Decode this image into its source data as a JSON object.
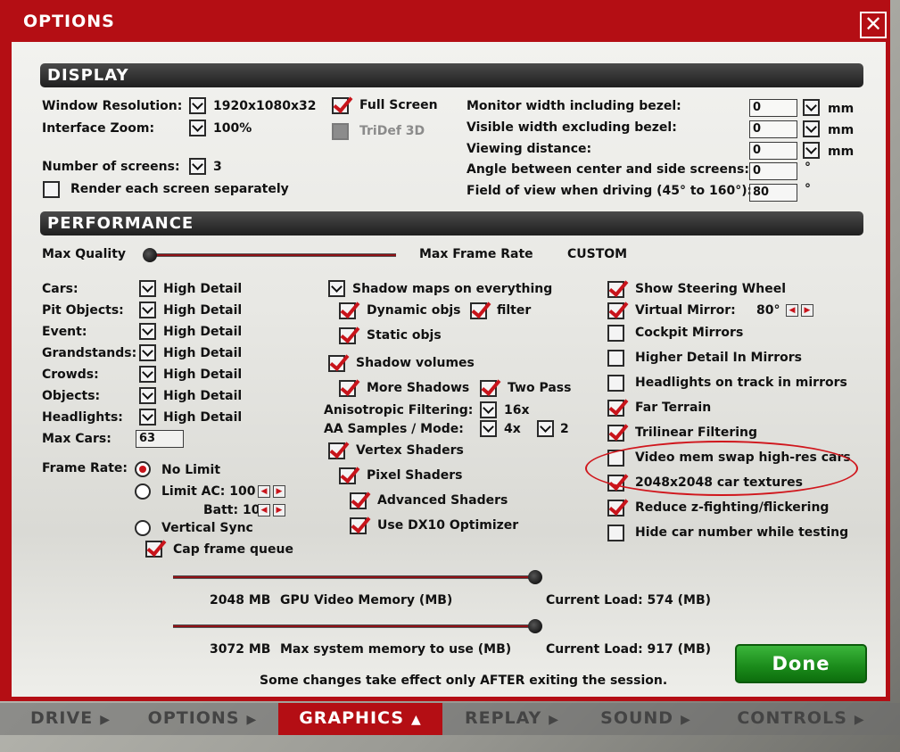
{
  "window": {
    "title": "OPTIONS",
    "close_icon": "close-icon",
    "accent": "#b40e14"
  },
  "display": {
    "header": "DISPLAY",
    "window_resolution_label": "Window Resolution:",
    "window_resolution_value": "1920x1080x32",
    "interface_zoom_label": "Interface Zoom:",
    "interface_zoom_value": "100%",
    "number_of_screens_label": "Number of screens:",
    "number_of_screens_value": "3",
    "render_separately_label": "Render each screen separately",
    "full_screen_label": "Full Screen",
    "tridef_label": "TriDef 3D",
    "monitor_width_label": "Monitor width including bezel:",
    "monitor_width_value": "0",
    "visible_width_label": "Visible width excluding bezel:",
    "visible_width_value": "0",
    "viewing_distance_label": "Viewing distance:",
    "viewing_distance_value": "0",
    "angle_label": "Angle between center and side screens:",
    "angle_value": "0",
    "fov_label": "Field of view when driving (45° to 160°):",
    "fov_value": "80",
    "unit_mm": "mm",
    "unit_deg": "°"
  },
  "performance": {
    "header": "PERFORMANCE",
    "max_quality_label": "Max Quality",
    "max_frame_rate_label": "Max Frame Rate",
    "preset_value": "CUSTOM",
    "detail_rows": [
      {
        "label": "Cars:",
        "value": "High Detail"
      },
      {
        "label": "Pit Objects:",
        "value": "High Detail"
      },
      {
        "label": "Event:",
        "value": "High Detail"
      },
      {
        "label": "Grandstands:",
        "value": "High Detail"
      },
      {
        "label": "Crowds:",
        "value": "High Detail"
      },
      {
        "label": "Objects:",
        "value": "High Detail"
      },
      {
        "label": "Headlights:",
        "value": "High Detail"
      }
    ],
    "max_cars_label": "Max Cars:",
    "max_cars_value": "63",
    "frame_rate_label": "Frame Rate:",
    "no_limit_label": "No Limit",
    "limit_ac_label": "Limit AC: 100",
    "batt_label": "Batt: 100",
    "vertical_sync_label": "Vertical Sync",
    "cap_frame_queue_label": "Cap frame queue",
    "shadow_maps_label": "Shadow maps on everything",
    "dynamic_objs_label": "Dynamic objs",
    "filter_label": "filter",
    "static_objs_label": "Static objs",
    "shadow_volumes_label": "Shadow volumes",
    "more_shadows_label": "More Shadows",
    "two_pass_label": "Two Pass",
    "anisotropic_label": "Anisotropic Filtering:",
    "anisotropic_value": "16x",
    "aa_label": "AA Samples / Mode:",
    "aa_samples_value": "4x",
    "aa_mode_value": "2",
    "vertex_shaders_label": "Vertex Shaders",
    "pixel_shaders_label": "Pixel Shaders",
    "advanced_shaders_label": "Advanced Shaders",
    "dx10_label": "Use DX10 Optimizer",
    "right_options": [
      {
        "label": "Show Steering Wheel",
        "checked": true
      },
      {
        "label": "Virtual Mirror:",
        "checked": true
      },
      {
        "label": "Cockpit Mirrors",
        "checked": false
      },
      {
        "label": "Higher Detail In Mirrors",
        "checked": false
      },
      {
        "label": "Headlights on track in mirrors",
        "checked": false
      },
      {
        "label": "Far Terrain",
        "checked": true
      },
      {
        "label": "Trilinear Filtering",
        "checked": true
      },
      {
        "label": "Video mem swap high-res cars",
        "checked": false
      },
      {
        "label": "2048x2048 car textures",
        "checked": true
      },
      {
        "label": "Reduce z-fighting/flickering",
        "checked": true
      },
      {
        "label": "Hide car number while testing",
        "checked": false
      }
    ],
    "virtual_mirror_fov": "80°",
    "gpu_memory_value": "2048 MB",
    "gpu_memory_label": "GPU Video Memory (MB)",
    "gpu_current_load": "Current Load: 574 (MB)",
    "system_memory_value": "3072 MB",
    "system_memory_label": "Max system memory to use (MB)",
    "system_current_load": "Current Load: 917 (MB)",
    "notice": "Some changes take effect only AFTER exiting the session."
  },
  "done_label": "Done",
  "nav_tabs": [
    {
      "label": "DRIVE",
      "active": false
    },
    {
      "label": "OPTIONS",
      "active": false
    },
    {
      "label": "GRAPHICS",
      "active": true
    },
    {
      "label": "REPLAY",
      "active": false
    },
    {
      "label": "SOUND",
      "active": false
    },
    {
      "label": "CONTROLS",
      "active": false
    }
  ]
}
